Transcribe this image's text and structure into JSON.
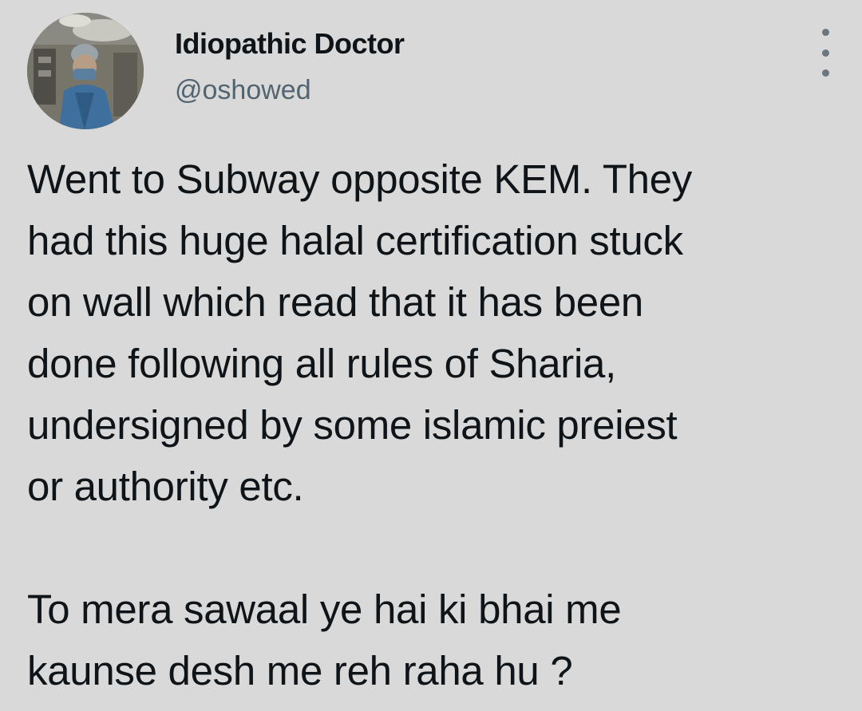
{
  "tweet": {
    "author": {
      "name": "Idiopathic Doctor",
      "handle": "@oshowed"
    },
    "more_icon": "ellipsis-vertical-icon",
    "paragraphs": [
      {
        "lines": [
          "Went to Subway opposite KEM. They",
          "had this huge halal certification stuck",
          "on wall which read that it has been",
          "done following all rules of Sharia,",
          "undersigned by some islamic preiest",
          "or authority etc."
        ]
      },
      {
        "lines": [
          "To mera sawaal ye hai ki bhai me",
          "kaunse desh me reh raha hu ?"
        ]
      }
    ]
  },
  "colors": {
    "background": "#d9d9d9",
    "text": "#0f1419",
    "secondary_text": "#536471"
  }
}
